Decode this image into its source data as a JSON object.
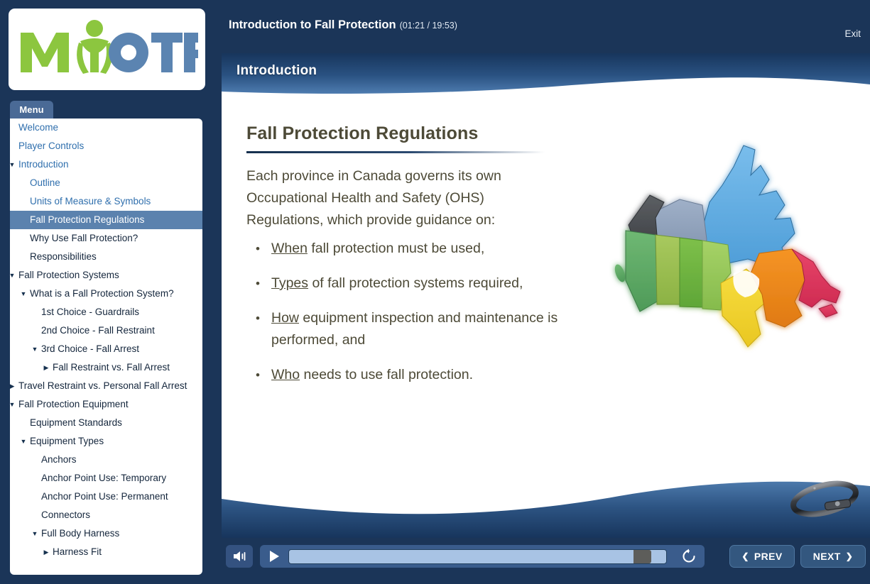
{
  "header": {
    "course_title": "Introduction to Fall Protection",
    "time_display": "(01:21 / 19:53)",
    "elapsed": "01:21",
    "duration": "19:53",
    "exit_label": "Exit"
  },
  "logo": {
    "text_my": "MY",
    "text_otf": "OTF",
    "alt": "MyOTF logo",
    "green": "#8CC63F",
    "blue": "#5B84B1"
  },
  "sidebar": {
    "tab_label": "Menu",
    "items": [
      {
        "label": "Welcome",
        "level": 0,
        "arrow": "",
        "state": "visited"
      },
      {
        "label": "Player Controls",
        "level": 0,
        "arrow": "",
        "state": "visited"
      },
      {
        "label": "Introduction",
        "level": 0,
        "arrow": "▼",
        "state": "visited"
      },
      {
        "label": "Outline",
        "level": 1,
        "arrow": "",
        "state": "visited"
      },
      {
        "label": "Units of Measure & Symbols",
        "level": 1,
        "arrow": "",
        "state": "visited"
      },
      {
        "label": "Fall Protection Regulations",
        "level": 1,
        "arrow": "",
        "state": "current"
      },
      {
        "label": "Why Use Fall Protection?",
        "level": 1,
        "arrow": "",
        "state": "unvisited"
      },
      {
        "label": "Responsibilities",
        "level": 1,
        "arrow": "",
        "state": "unvisited"
      },
      {
        "label": "Fall Protection Systems",
        "level": 0,
        "arrow": "▼",
        "state": "unvisited"
      },
      {
        "label": "What is a Fall Protection System?",
        "level": 1,
        "arrow": "▼",
        "state": "unvisited"
      },
      {
        "label": "1st Choice - Guardrails",
        "level": 2,
        "arrow": "",
        "state": "unvisited"
      },
      {
        "label": "2nd Choice - Fall Restraint",
        "level": 2,
        "arrow": "",
        "state": "unvisited"
      },
      {
        "label": "3rd Choice - Fall Arrest",
        "level": 2,
        "arrow": "▼",
        "state": "unvisited"
      },
      {
        "label": "Fall Restraint vs. Fall Arrest",
        "level": 3,
        "arrow": "▶",
        "state": "unvisited"
      },
      {
        "label": "Travel Restraint vs. Personal Fall Arrest",
        "level": 0,
        "arrow": "▶",
        "state": "unvisited"
      },
      {
        "label": "Fall Protection Equipment",
        "level": 0,
        "arrow": "▼",
        "state": "unvisited"
      },
      {
        "label": "Equipment Standards",
        "level": 1,
        "arrow": "",
        "state": "unvisited"
      },
      {
        "label": "Equipment Types",
        "level": 1,
        "arrow": "▼",
        "state": "unvisited"
      },
      {
        "label": "Anchors",
        "level": 2,
        "arrow": "",
        "state": "unvisited"
      },
      {
        "label": "Anchor Point Use: Temporary",
        "level": 2,
        "arrow": "",
        "state": "unvisited"
      },
      {
        "label": "Anchor Point Use: Permanent",
        "level": 2,
        "arrow": "",
        "state": "unvisited"
      },
      {
        "label": "Connectors",
        "level": 2,
        "arrow": "",
        "state": "unvisited"
      },
      {
        "label": "Full Body Harness",
        "level": 2,
        "arrow": "▼",
        "state": "unvisited"
      },
      {
        "label": "Harness Fit",
        "level": 3,
        "arrow": "▶",
        "state": "unvisited"
      }
    ]
  },
  "slide": {
    "section_label": "Introduction",
    "heading": "Fall Protection Regulations",
    "paragraph": "Each province in Canada governs its own Occupational Health and Safety (OHS) Regulations, which provide guidance on:",
    "bullets": [
      {
        "lead": "When",
        "rest": " fall protection must be used,"
      },
      {
        "lead": "Types",
        "rest": " of fall protection systems required,"
      },
      {
        "lead": "How",
        "rest": " equipment inspection and maintenance is performed, and"
      },
      {
        "lead": "Who",
        "rest": " needs to use fall protection."
      }
    ],
    "image_alt": "3D map of Canada with provinces in different colors",
    "decoration_alt": "carabiner"
  },
  "controls": {
    "volume_icon": "speaker-icon",
    "play_icon": "play-icon",
    "replay_icon": "replay-icon",
    "prev_label": "PREV",
    "next_label": "NEXT",
    "prev_chevron": "❮",
    "next_chevron": "❯",
    "seek_percent": 96
  },
  "colors": {
    "chrome_navy": "#1b3558",
    "accent_blue": "#5b82ae",
    "slide_text": "#4d4a37",
    "link_blue": "#2f6fad"
  }
}
